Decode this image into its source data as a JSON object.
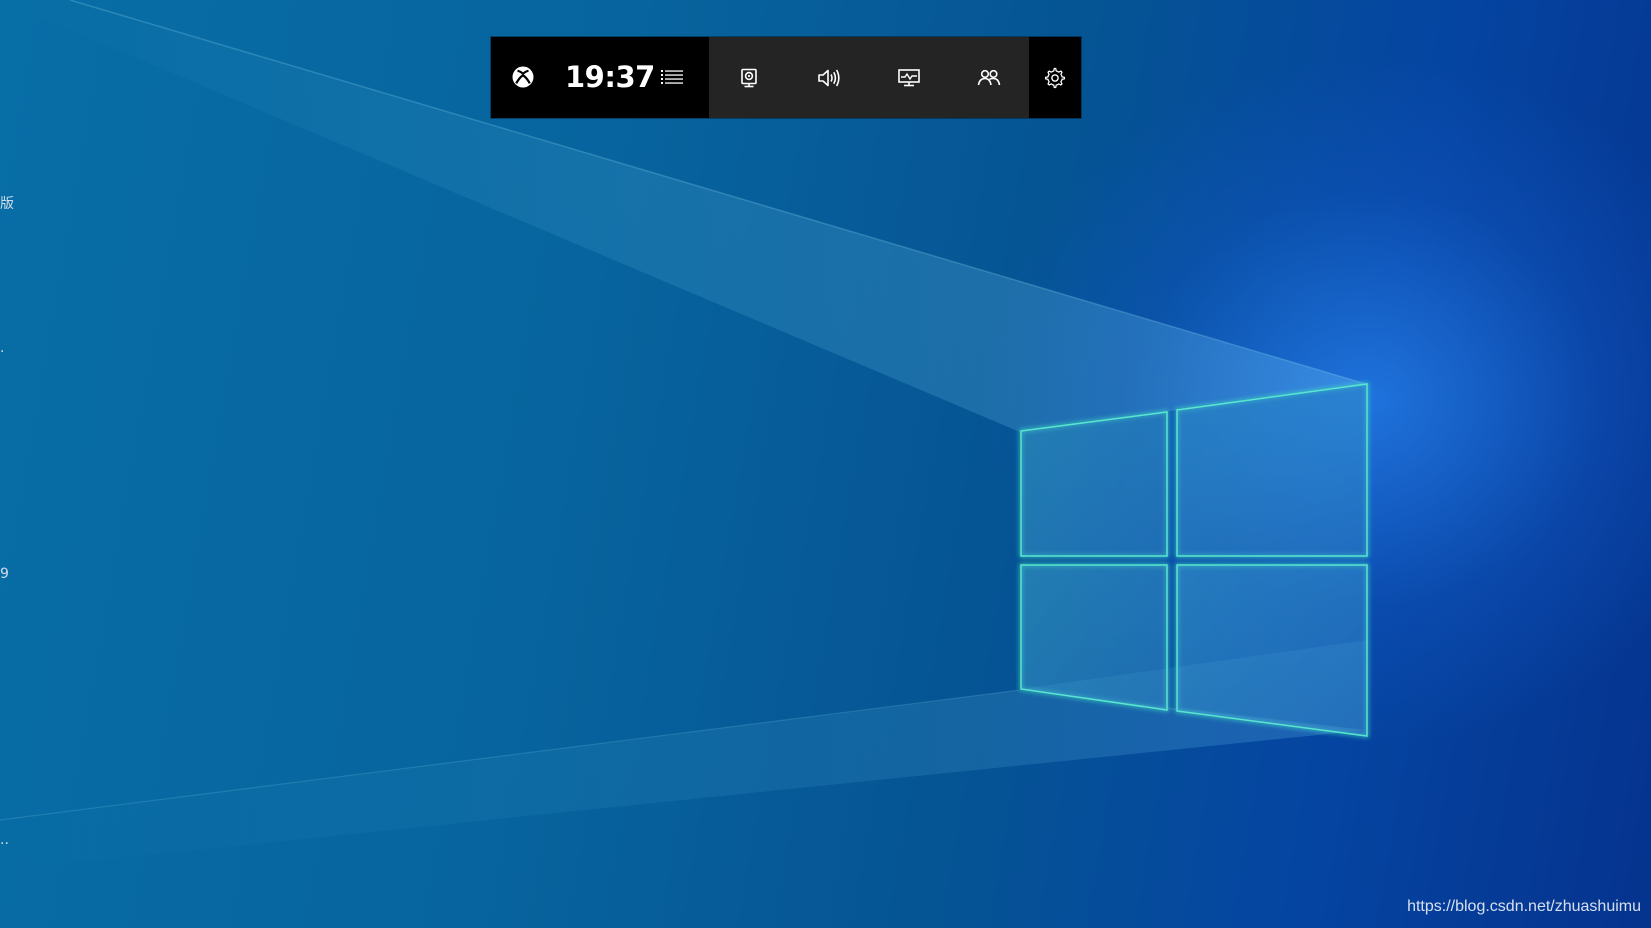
{
  "game_bar": {
    "clock": "19:37",
    "buttons": [
      {
        "name": "xbox-button",
        "icon": "xbox-icon"
      },
      {
        "name": "menu-button",
        "icon": "list-icon"
      },
      {
        "name": "capture-widget-button",
        "icon": "webcam-icon"
      },
      {
        "name": "audio-widget-button",
        "icon": "speaker-icon"
      },
      {
        "name": "performance-widget-button",
        "icon": "monitor-chart-icon"
      },
      {
        "name": "social-widget-button",
        "icon": "people-icon"
      },
      {
        "name": "settings-button",
        "icon": "gear-icon"
      }
    ]
  },
  "desktop": {
    "edge_text_1": "版",
    "edge_text_2": ".",
    "edge_text_3": "9",
    "edge_text_4": "..",
    "watermark": "https://blog.csdn.net/zhuashuimu"
  },
  "colors": {
    "bar_dark": "#000000",
    "bar_mid": "#242424",
    "logo_edge": "#4de0c8"
  }
}
